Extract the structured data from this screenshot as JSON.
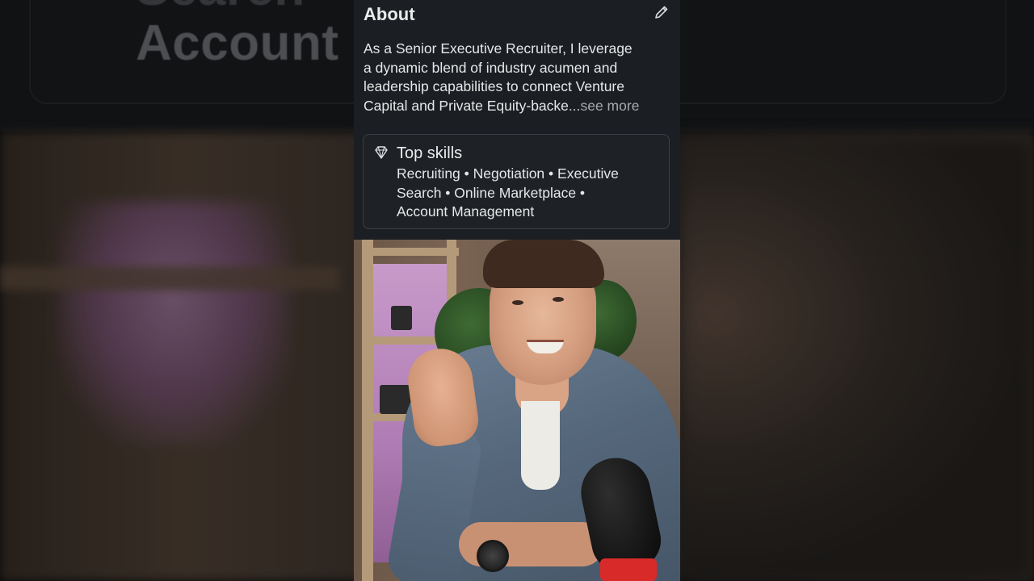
{
  "backdrop": {
    "top_text_line1": "Search",
    "top_text_line2": "Account M"
  },
  "about": {
    "title": "About",
    "edit_icon": "pencil-icon",
    "lines": [
      "As a Senior Executive Recruiter, I leverage",
      "a dynamic blend of industry acumen and",
      "leadership capabilities to connect Venture",
      "Capital and Private Equity-backe"
    ],
    "truncated_tail": "...",
    "see_more": "see more"
  },
  "top_skills": {
    "icon": "diamond-icon",
    "title": "Top skills",
    "line1": "Recruiting • Negotiation • Executive",
    "line2": "Search • Online Marketplace •",
    "line3": "Account Management"
  },
  "colors": {
    "panel_bg": "#1b1f23",
    "text_primary": "#e6e7e8",
    "text_muted": "#a7abaf",
    "card_border": "#3a3f45"
  }
}
